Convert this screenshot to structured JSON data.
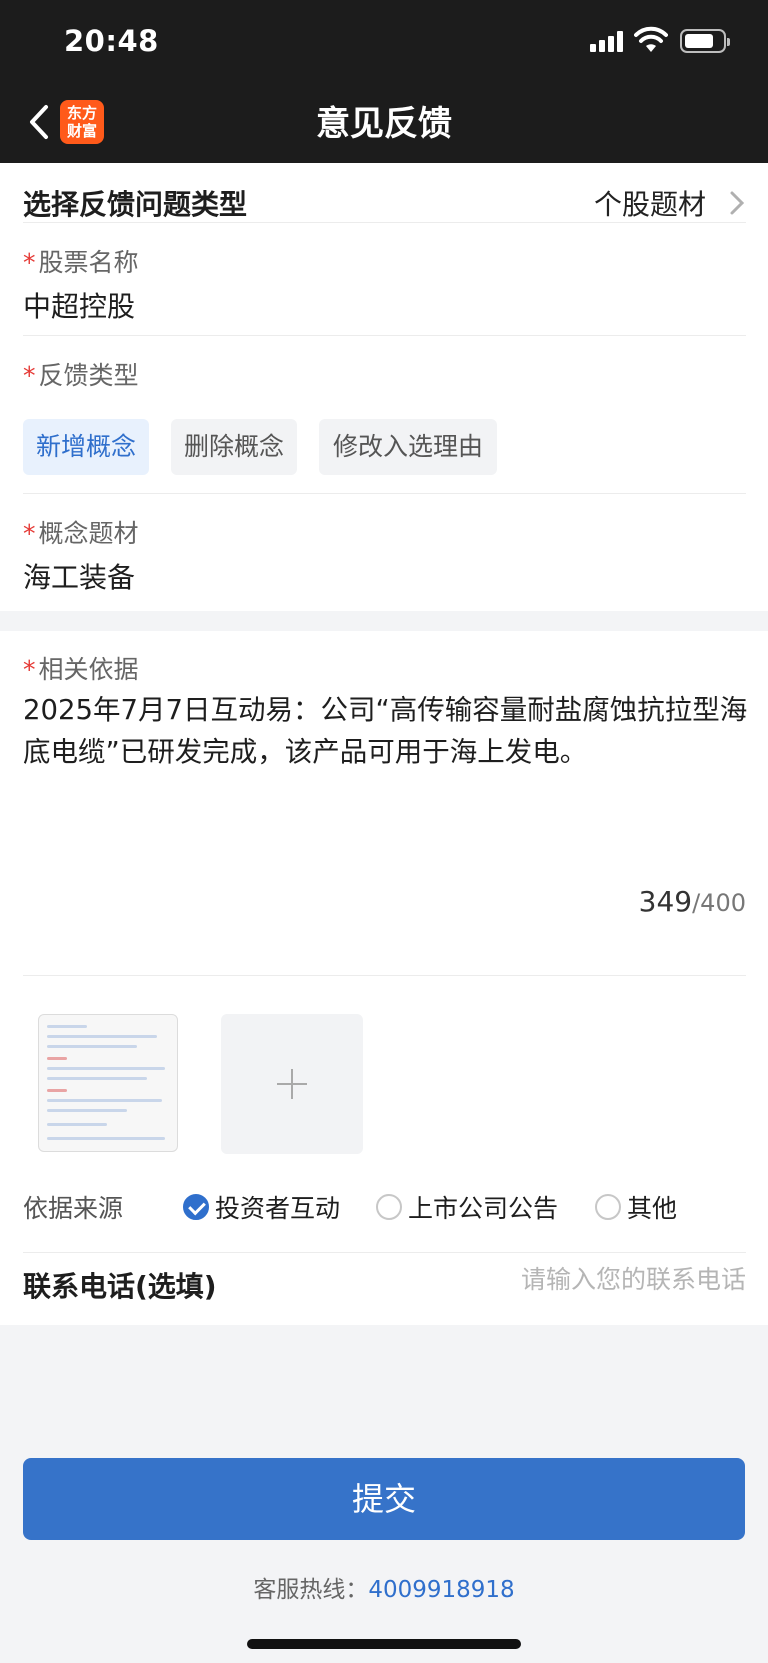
{
  "status_bar": {
    "time": "20:48"
  },
  "nav": {
    "title": "意见反馈",
    "logo_line1": "东方",
    "logo_line2": "财富"
  },
  "issue_type": {
    "label": "选择反馈问题类型",
    "value": "个股题材"
  },
  "stock_name": {
    "label": "股票名称",
    "value": "中超控股"
  },
  "feedback_type": {
    "label": "反馈类型",
    "options": [
      "新增概念",
      "删除概念",
      "修改入选理由"
    ],
    "selected": "新增概念"
  },
  "concept": {
    "label": "概念题材",
    "value": "海工装备"
  },
  "basis": {
    "label": "相关依据",
    "text": "2025年7月7日互动易：公司“高传输容量耐盐腐蚀抗拉型海底电缆”已研发完成，该产品可用于海上发电。",
    "count": "349",
    "max": "/400"
  },
  "source": {
    "label": "依据来源",
    "options": [
      "投资者互动",
      "上市公司公告",
      "其他"
    ],
    "selected": "投资者互动"
  },
  "phone": {
    "label": "联系电话(选填)",
    "placeholder": "请输入您的联系电话"
  },
  "submit_label": "提交",
  "hotline": {
    "label": "客服热线：",
    "number": "4009918918"
  },
  "colors": {
    "accent": "#3673c9",
    "required": "#e53935",
    "brand_logo": "#ff5a1a"
  },
  "required_mark": "*"
}
